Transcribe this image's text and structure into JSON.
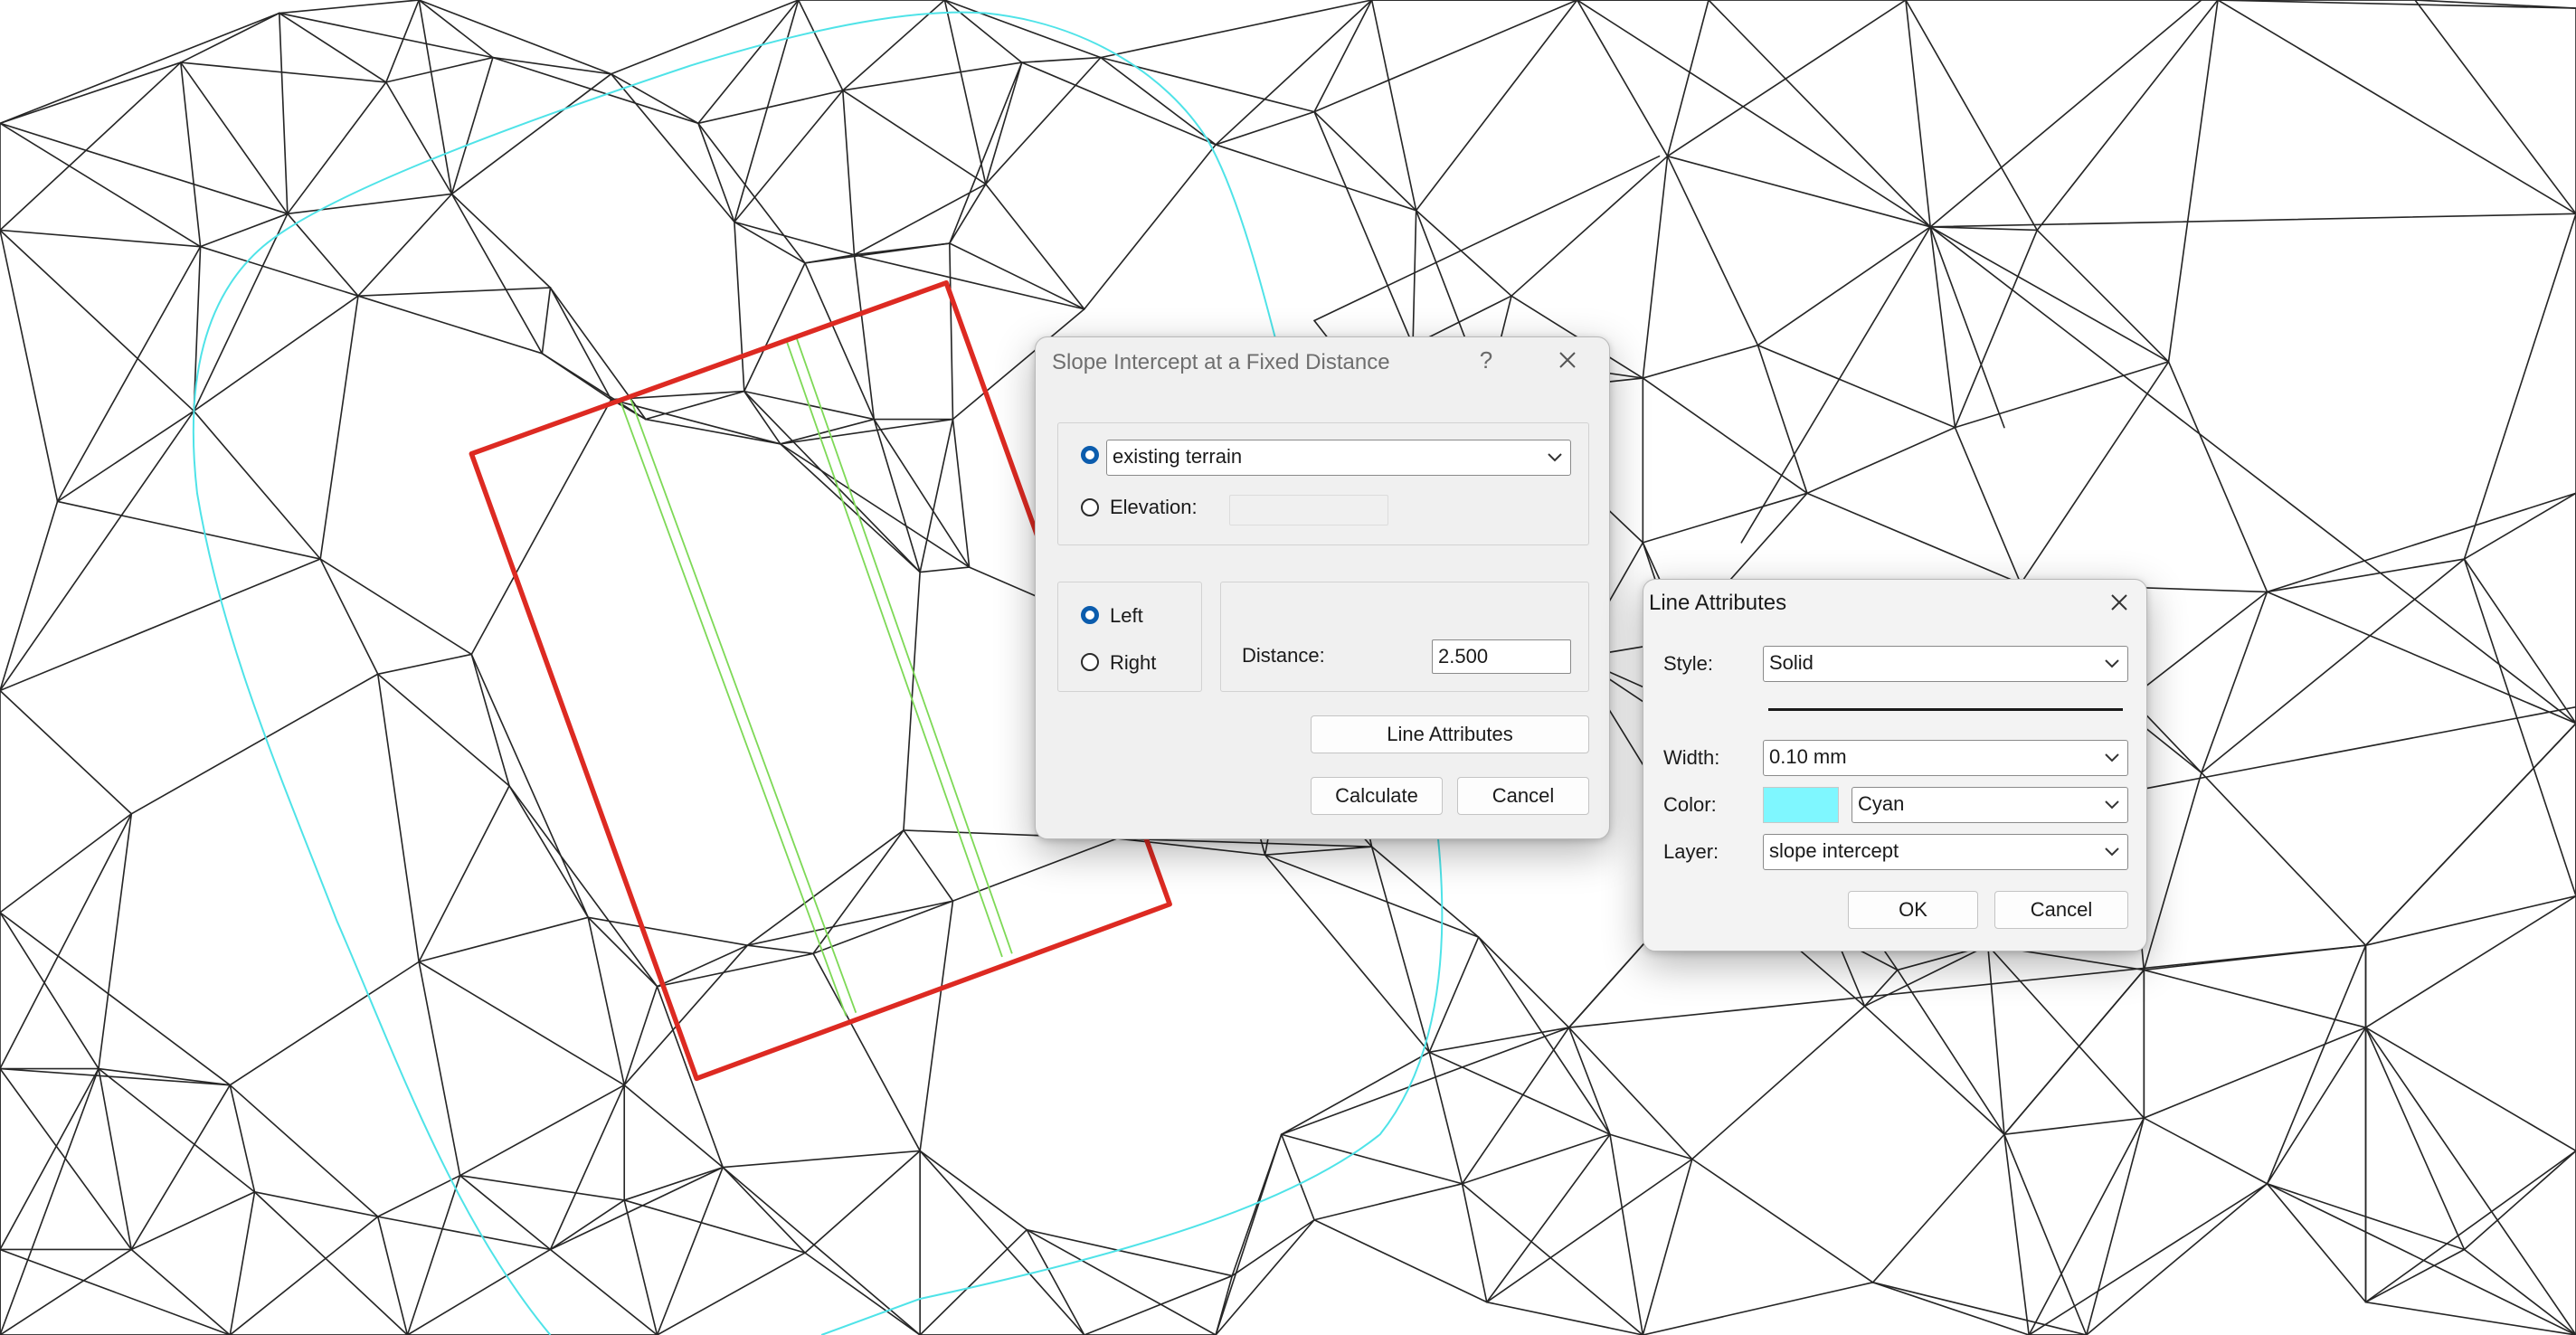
{
  "slope_dialog": {
    "title": "Slope Intercept at a Fixed Distance",
    "help_glyph": "?",
    "surface_value": "existing terrain",
    "elevation_label": "Elevation:",
    "elevation_value": "",
    "left_label": "Left",
    "right_label": "Right",
    "distance_label": "Distance:",
    "distance_value": "2.500",
    "line_attributes_button": "Line Attributes",
    "calculate_button": "Calculate",
    "cancel_button": "Cancel",
    "surface_selected": true,
    "left_selected": true
  },
  "line_attributes_dialog": {
    "title": "Line Attributes",
    "style_label": "Style:",
    "style_value": "Solid",
    "width_label": "Width:",
    "width_value": "0.10 mm",
    "color_label": "Color:",
    "color_value": "Cyan",
    "color_swatch": "#7ff7ff",
    "layer_label": "Layer:",
    "layer_value": "slope intercept",
    "ok_button": "OK",
    "cancel_button": "Cancel"
  },
  "colors": {
    "mesh": "#262626",
    "boundary": "#dd2a22",
    "slope_lines": "#7ed957",
    "offset_contour": "#4fe3e8",
    "radio_selected": "#0b5cad"
  },
  "icons": [
    "close-icon",
    "help-icon",
    "chevron-down-icon"
  ]
}
